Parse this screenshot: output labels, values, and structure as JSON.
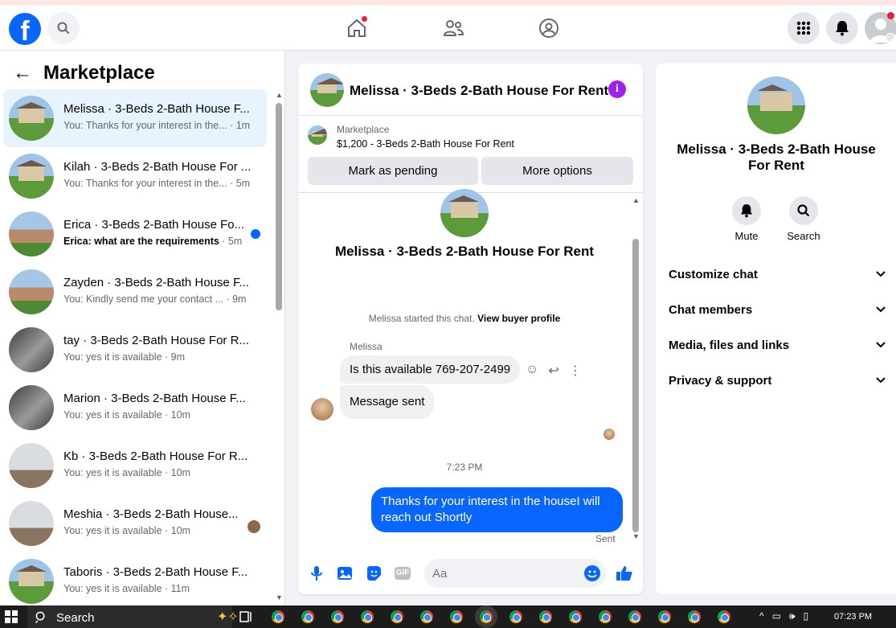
{
  "header": {
    "logo": "f",
    "icons": [
      "search-icon",
      "home-icon",
      "friends-icon",
      "groups-icon",
      "menu-grid-icon",
      "bell-icon",
      "avatar"
    ]
  },
  "sidebar": {
    "back": "←",
    "title": "Marketplace",
    "conversations": [
      {
        "title": "Melissa · 3-Beds 2-Bath House F...",
        "preview": "You: Thanks for your interest in the... ",
        "ago": "· 1m",
        "unread": false
      },
      {
        "title": "Kilah · 3-Beds 2-Bath House For ...",
        "preview": "You: Thanks for your interest in the... ",
        "ago": "· 5m",
        "unread": false
      },
      {
        "title": "Erica · 3-Beds 2-Bath House Fo...",
        "preview": "Erica: what are the requirements ",
        "ago": "· 5m",
        "unread": true
      },
      {
        "title": "Zayden · 3-Beds 2-Bath House F...",
        "preview": "You: Kindly send me your contact ... ",
        "ago": "· 9m",
        "unread": false
      },
      {
        "title": "tay · 3-Beds 2-Bath House For R...",
        "preview": "You: yes it is available ",
        "ago": "· 9m",
        "unread": false
      },
      {
        "title": "Marion · 3-Beds 2-Bath House F...",
        "preview": "You: yes it is available ",
        "ago": "· 10m",
        "unread": false
      },
      {
        "title": "Kb · 3-Beds 2-Bath House For R...",
        "preview": "You: yes it is available ",
        "ago": "· 10m",
        "unread": false
      },
      {
        "title": "Meshia · 3-Beds 2-Bath House...",
        "preview": "You: yes it is available ",
        "ago": "· 10m",
        "unread": false
      },
      {
        "title": "Taboris · 3-Beds 2-Bath House F...",
        "preview": "You: yes it is available ",
        "ago": "· 11m",
        "unread": false
      }
    ]
  },
  "chat": {
    "title": "Melissa · 3-Beds 2-Bath House For Rent",
    "listing": {
      "label": "Marketplace",
      "price_title": "$1,200 - 3-Beds 2-Bath House For Rent",
      "pending_button": "Mark as pending",
      "more_button": "More options"
    },
    "intro_title": "Melissa · 3-Beds 2-Bath House For Rent",
    "started_text": "Melissa started this chat. ",
    "view_profile": "View buyer profile",
    "sender_name": "Melissa",
    "incoming": [
      "Is this available 769-207-2499",
      "Message sent"
    ],
    "timestamp": "7:23 PM",
    "outgoing": "Thanks for your interest in the houseI will reach out Shortly",
    "sent_label": "Sent",
    "composer_placeholder": "Aa",
    "composer_gif": "GIF"
  },
  "details": {
    "title": "Melissa · 3-Beds 2-Bath House For Rent",
    "mute": "Mute",
    "search": "Search",
    "sections": [
      "Customize chat",
      "Chat members",
      "Media, files and links",
      "Privacy & support"
    ]
  },
  "taskbar": {
    "search_label": "Search",
    "time": "07:23 PM"
  }
}
